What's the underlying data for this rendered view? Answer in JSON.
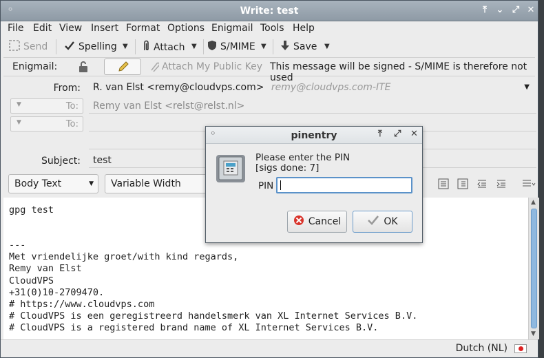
{
  "window": {
    "title": "Write: test"
  },
  "dialog": {
    "title": "pinentry",
    "prompt_line1": "Please enter the PIN",
    "prompt_line2": "[sigs done: 7]",
    "pin_label": "PIN",
    "pin_value": "",
    "cancel_label": "Cancel",
    "ok_label": "OK"
  },
  "menu": [
    {
      "label": "File"
    },
    {
      "label": "Edit"
    },
    {
      "label": "View"
    },
    {
      "label": "Insert"
    },
    {
      "label": "Format"
    },
    {
      "label": "Options"
    },
    {
      "label": "Enigmail"
    },
    {
      "label": "Tools"
    },
    {
      "label": "Help"
    }
  ],
  "toolbar": {
    "send": "Send",
    "spelling": "Spelling",
    "attach": "Attach",
    "smime": "S/MIME",
    "save": "Save"
  },
  "enigmail": {
    "label": "Enigmail:",
    "attach_key": "Attach My Public Key",
    "status": "This message will be signed - S/MIME is therefore not used"
  },
  "header": {
    "from_label": "From:",
    "from_value": "R. van Elst <remy@cloudvps.com>",
    "from_identity": "remy@cloudvps.com-ITE",
    "to_label": "To:",
    "to_value": "Remy van Elst <relst@relst.nl>",
    "subject_label": "Subject:",
    "subject_value": "test"
  },
  "format": {
    "paragraph": "Body Text",
    "font": "Variable Width"
  },
  "body_lines": [
    "gpg test",
    "",
    "",
    "---",
    "Met vriendelijke groet/with kind regards,",
    "Remy van Elst",
    "CloudVPS",
    "+31(0)10-2709470.",
    "# https://www.cloudvps.com",
    "# CloudVPS is een geregistreerd handelsmerk van XL Internet Services B.V.",
    "# CloudVPS is a registered brand name of XL Internet Services B.V."
  ],
  "status": {
    "language": "Dutch (NL)"
  }
}
